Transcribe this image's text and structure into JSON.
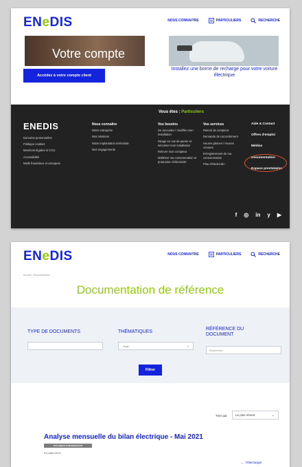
{
  "brand": {
    "logo_prefix": "EN",
    "logo_e": "e",
    "logo_suffix": "DIS",
    "footer_logo": "ENEDIS",
    "blue": "#1423dc",
    "green": "#93c90e"
  },
  "nav": {
    "nous_connaitre": "NOUS CONNAITRE",
    "particuliers": "PARTICULIERS",
    "recherche": "RECHERCHE"
  },
  "top": {
    "hero_title": "Votre compte",
    "access_button": "Accédez à votre compte client",
    "borne_text": "Installez une borne de recharge pour votre voiture électrique"
  },
  "footer": {
    "vous_etes_label": "Vous êtes :",
    "vous_etes_value": "Particuliers",
    "col1_items": [
      "Données personnelles",
      "Politique cookies",
      "Mentions légales et CGU",
      "Accessibilité",
      "Mails frauduleux et arnaques"
    ],
    "col2_title": "Nous connaître",
    "col2_items": [
      "Notre entreprise",
      "Nos missions",
      "Notre implantation territoriale",
      "Nos engagements"
    ],
    "col3_title": "Vos besoins",
    "col3_items": [
      "Se raccorder / modifier mon installation",
      "Réagir en cas de panne et sécuriser mon installation",
      "Relever mon compteur",
      "Maîtriser ma consommation et production d'électricité"
    ],
    "col4_title": "Vos services",
    "col4_items": [
      "Relevé de compteur",
      "Demande de raccordement",
      "Heures pleines / Heures creuses",
      "Enregistrement de ma consommation",
      "Plus d'électricité !"
    ],
    "col5_items": [
      "Aide & Contact",
      "Offres d'emploi",
      "Médias",
      "Documentation",
      "Espace prestataires"
    ],
    "socials": [
      "f",
      "◎",
      "in",
      "y",
      "▶"
    ]
  },
  "doc": {
    "breadcrumb": "Accueil › Documentation",
    "title": "Documentation de référence",
    "type_label": "TYPE DE DOCUMENTS",
    "thematiques_label": "THÉMATIQUES",
    "thematiques_value": "- Tout -",
    "reference_label_1": "RÉFÉRENCE DU",
    "reference_label_2": "DOCUMENT",
    "reference_placeholder": "Recherche",
    "filter_button": "Filtrer",
    "sort_label": "Trier par",
    "sort_value": "Le plus récent",
    "result_title": "Analyse mensuelle du bilan électrique - Mai 2021",
    "result_badge": "DOCUMENT D'INFORMATION",
    "result_date": "01 juillet 2024",
    "download": "Télécharger"
  }
}
